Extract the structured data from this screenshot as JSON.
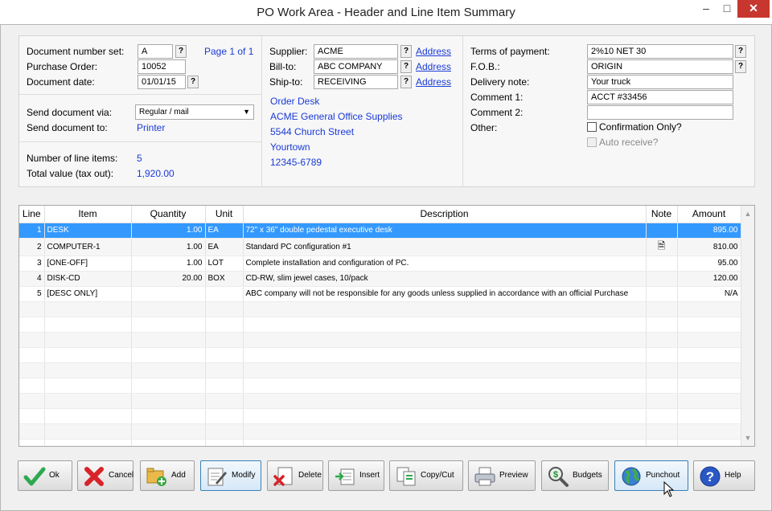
{
  "window": {
    "title": "PO Work Area - Header and Line Item Summary",
    "minimize": "–",
    "maximize": "□",
    "close": "✕"
  },
  "doc": {
    "number_set_label": "Document number set:",
    "number_set_value": "A",
    "page_text": "Page 1 of 1",
    "po_label": "Purchase Order:",
    "po_value": "10052",
    "date_label": "Document date:",
    "date_value": "01/01/15",
    "send_via_label": "Send document via:",
    "send_via_value": "Regular / mail",
    "send_to_label": "Send document to:",
    "send_to_value": "Printer",
    "line_items_label": "Number of line items:",
    "line_items_value": "5",
    "total_label": "Total value (tax out):",
    "total_value": "1,920.00"
  },
  "supplier": {
    "supplier_label": "Supplier:",
    "supplier_value": "ACME",
    "billto_label": "Bill-to:",
    "billto_value": "ABC COMPANY",
    "shipto_label": "Ship-to:",
    "shipto_value": "RECEIVING",
    "address_link": "Address",
    "address_lines": [
      "Order Desk",
      "ACME General Office Supplies",
      "5544 Church Street",
      "Yourtown",
      "12345-6789"
    ]
  },
  "terms": {
    "payment_label": "Terms of payment:",
    "payment_value": "2%10 NET 30",
    "fob_label": "F.O.B.:",
    "fob_value": "ORIGIN",
    "delivery_label": "Delivery note:",
    "delivery_value": "Your truck",
    "comment1_label": "Comment 1:",
    "comment1_value": "ACCT #33456",
    "comment2_label": "Comment 2:",
    "comment2_value": "",
    "other_label": "Other:",
    "confirmation_label": "Confirmation Only?",
    "auto_receive_label": "Auto receive?"
  },
  "qbutton": "?",
  "grid": {
    "columns": [
      "Line",
      "Item",
      "Quantity",
      "Unit",
      "Description",
      "Note",
      "Amount"
    ],
    "rows": [
      [
        "1",
        "DESK",
        "1.00",
        "EA",
        "72\" x 36\" double pedestal executive desk",
        "",
        "895.00"
      ],
      [
        "2",
        "COMPUTER-1",
        "1.00",
        "EA",
        "Standard PC configuration #1",
        "note",
        "810.00"
      ],
      [
        "3",
        "[ONE-OFF]",
        "1.00",
        "LOT",
        "Complete installation and configuration of PC.",
        "",
        "95.00"
      ],
      [
        "4",
        "DISK-CD",
        "20.00",
        "BOX",
        "CD-RW, slim jewel cases, 10/pack",
        "",
        "120.00"
      ],
      [
        "5",
        "[DESC ONLY]",
        "",
        "",
        "ABC company will not be responsible for any goods unless supplied in accordance with an official Purchase",
        "",
        "N/A"
      ]
    ],
    "selected_row": 0,
    "empty_rows": 10
  },
  "buttons": [
    {
      "name": "ok-button",
      "label": "Ok",
      "icon": "checkmark-icon"
    },
    {
      "name": "cancel-button",
      "label": "Cancel",
      "icon": "x-icon"
    },
    {
      "name": "add-button",
      "label": "Add",
      "icon": "folder-add-icon"
    },
    {
      "name": "modify-button",
      "label": "Modify",
      "icon": "edit-document-icon"
    },
    {
      "name": "delete-button",
      "label": "Delete",
      "icon": "delete-document-icon"
    },
    {
      "name": "insert-button",
      "label": "Insert",
      "icon": "insert-icon"
    },
    {
      "name": "copycut-button",
      "label": "Copy/Cut",
      "icon": "copy-icon"
    },
    {
      "name": "preview-button",
      "label": "Preview",
      "icon": "printer-icon"
    },
    {
      "name": "budgets-button",
      "label": "Budgets",
      "icon": "magnifier-money-icon"
    },
    {
      "name": "punchout-button",
      "label": "Punchout",
      "icon": "globe-icon"
    },
    {
      "name": "help-button",
      "label": "Help",
      "icon": "help-icon"
    }
  ],
  "colors": {
    "link": "#1a3ad6",
    "selection": "#3399ff",
    "close": "#c7372f",
    "ok_green": "#2fa84f",
    "cancel_red": "#d8232a"
  }
}
